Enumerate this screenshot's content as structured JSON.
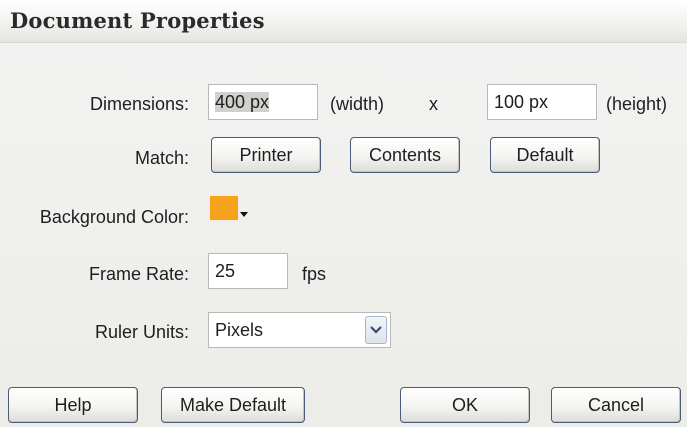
{
  "window": {
    "title": "Document Properties"
  },
  "dimensions": {
    "label": "Dimensions:",
    "width_value": "400 px",
    "width_suffix": "(width)",
    "separator": "x",
    "height_value": "100 px",
    "height_suffix": "(height)"
  },
  "match": {
    "label": "Match:",
    "printer_label": "Printer",
    "contents_label": "Contents",
    "default_label": "Default"
  },
  "background": {
    "label": "Background Color:",
    "color": "#f7a21b"
  },
  "frame_rate": {
    "label": "Frame Rate:",
    "value": "25",
    "unit": "fps"
  },
  "ruler_units": {
    "label": "Ruler Units:",
    "selected": "Pixels",
    "dropdown_icon": "chevron-down-icon"
  },
  "footer": {
    "help_label": "Help",
    "make_default_label": "Make Default",
    "ok_label": "OK",
    "cancel_label": "Cancel"
  },
  "colors": {
    "button_border": "#4a5a78",
    "field_border": "#b8b8b8"
  }
}
